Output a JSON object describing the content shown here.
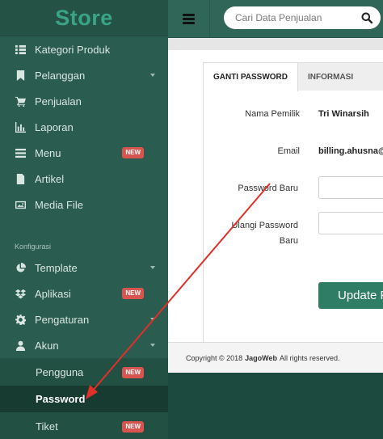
{
  "brand": "Store",
  "search": {
    "placeholder": "Cari Data Penjualan"
  },
  "menu": [
    {
      "label": "Kategori Produk",
      "icon": "list-icon"
    },
    {
      "label": "Pelanggan",
      "icon": "bookmark-icon",
      "caret": true
    },
    {
      "label": "Penjualan",
      "icon": "cart-icon"
    },
    {
      "label": "Laporan",
      "icon": "bar-chart-icon"
    },
    {
      "label": "Menu",
      "icon": "menu-icon",
      "badge": "NEW"
    },
    {
      "label": "Artikel",
      "icon": "file-icon"
    },
    {
      "label": "Media File",
      "icon": "image-icon"
    }
  ],
  "section_label": "Konfigurasi",
  "config_menu": [
    {
      "label": "Template",
      "icon": "pie-icon",
      "caret": true
    },
    {
      "label": "Aplikasi",
      "icon": "dropbox-icon",
      "badge": "NEW"
    },
    {
      "label": "Pengaturan",
      "icon": "gear-icon",
      "caret": true
    },
    {
      "label": "Akun",
      "icon": "user-icon",
      "caret": true
    }
  ],
  "akun_sub": [
    {
      "label": "Pengguna",
      "badge": "NEW"
    },
    {
      "label": "Password",
      "active": true
    },
    {
      "label": "Tiket",
      "badge": "NEW"
    }
  ],
  "tabs": [
    "GANTI PASSWORD",
    "INFORMASI"
  ],
  "form": {
    "nama_label": "Nama Pemilik",
    "nama_value": "Tri Winarsih",
    "email_label": "Email",
    "email_value": "billing.ahusna@",
    "password_baru_label": "Password Baru",
    "ulangi_label_1": "Ulangi Password",
    "ulangi_label_2": "Baru",
    "submit_label": "Update P"
  },
  "footer": {
    "prefix": "Copyright © 2018",
    "brand": "JagoWeb",
    "suffix": "All rights reserved."
  },
  "colors": {
    "sidebar": "#2a5c4f",
    "brand_text": "#3aa486",
    "badge": "#d9534f",
    "button": "#2f7d64",
    "arrow": "#e0302a"
  }
}
